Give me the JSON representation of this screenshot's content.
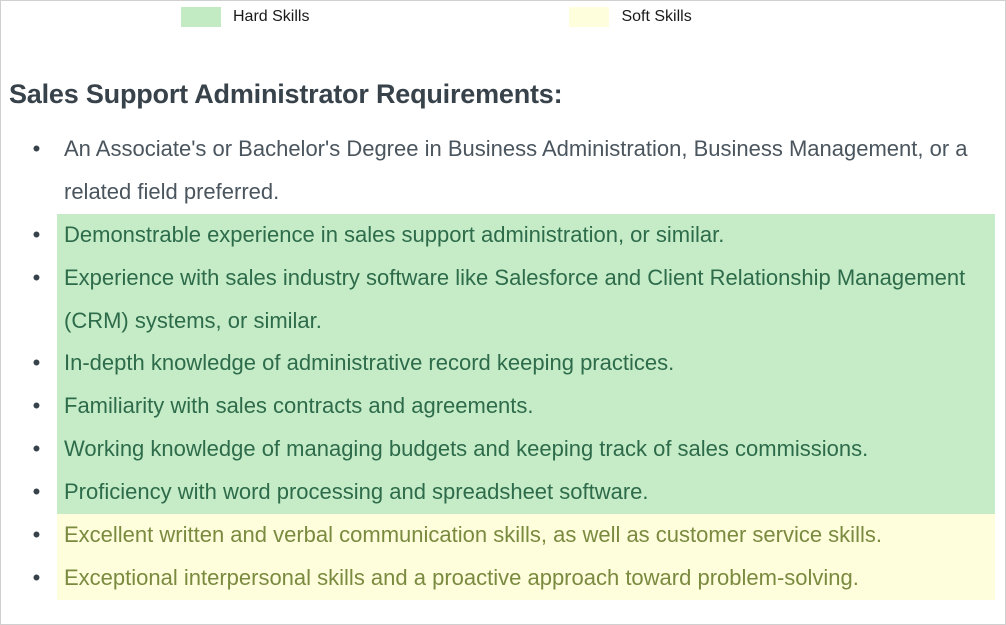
{
  "legend": {
    "hard_label": "Hard Skills",
    "soft_label": "Soft Skills"
  },
  "heading": "Sales Support Administrator Requirements:",
  "items": [
    {
      "text": "An Associate's or Bachelor's Degree in Business Administration, Business Management, or a related field preferred.",
      "category": "none"
    },
    {
      "text": "Demonstrable experience in sales support administration, or similar.",
      "category": "hard"
    },
    {
      "text": "Experience with sales industry software like Salesforce and Client Relationship Management (CRM) systems, or similar.",
      "category": "hard"
    },
    {
      "text": "In-depth knowledge of administrative record keeping practices.",
      "category": "hard"
    },
    {
      "text": "Familiarity with sales contracts and agreements.",
      "category": "hard"
    },
    {
      "text": "Working knowledge of managing budgets and keeping track of sales commissions.",
      "category": "hard"
    },
    {
      "text": "Proficiency with word processing and spreadsheet software.",
      "category": "hard"
    },
    {
      "text": "Excellent written and verbal communication skills, as well as customer service skills.",
      "category": "soft"
    },
    {
      "text": "Exceptional interpersonal skills and a proactive approach toward problem-solving.",
      "category": "soft"
    }
  ],
  "colors": {
    "hard_highlight": "#c5ecc7",
    "soft_highlight": "#fefddc",
    "hard_text": "#2d6b4a",
    "soft_text": "#7a8a3f",
    "plain_text": "#4a555e",
    "heading_text": "#37424a"
  }
}
